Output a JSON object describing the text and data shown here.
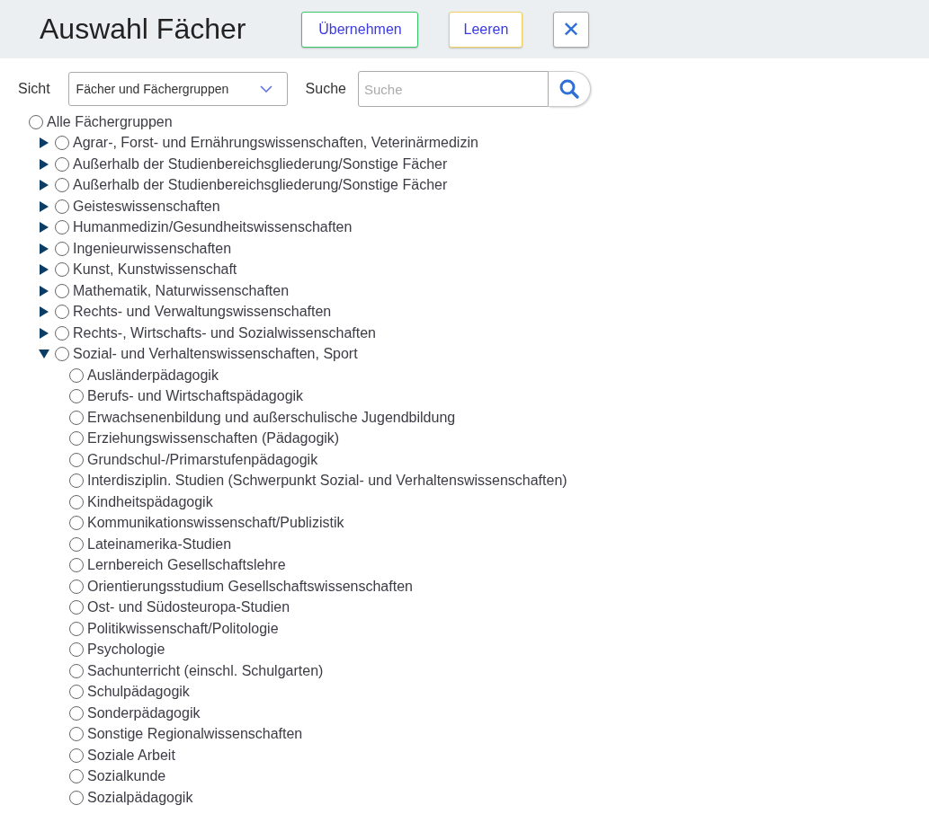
{
  "header": {
    "title": "Auswahl Fächer",
    "buttons": [
      {
        "label": "Übernehmen",
        "kind": "apply"
      },
      {
        "label": "Leeren",
        "kind": "clear"
      }
    ],
    "close": {
      "label": "✕"
    }
  },
  "filters": {
    "view_label": "Sicht",
    "view_value": "Fächer und Fächergruppen",
    "search_label": "Suche",
    "search_placeholder": "Suche"
  },
  "tree": {
    "label": "Alle Fächergruppen",
    "selected": false,
    "children": [
      {
        "label": "Agrar-, Forst- und Ernährungswissenschaften, Veterinärmedizin",
        "selected": false,
        "expanded": false
      },
      {
        "label": "Außerhalb der Studienbereichsgliederung/Sonstige Fächer",
        "selected": false,
        "expanded": false
      },
      {
        "label": "Außerhalb der Studienbereichsgliederung/Sonstige Fächer",
        "selected": false,
        "expanded": false
      },
      {
        "label": "Geisteswissenschaften",
        "selected": false,
        "expanded": false
      },
      {
        "label": "Humanmedizin/Gesundheitswissenschaften",
        "selected": false,
        "expanded": false
      },
      {
        "label": "Ingenieurwissenschaften",
        "selected": false,
        "expanded": false
      },
      {
        "label": "Kunst, Kunstwissenschaft",
        "selected": false,
        "expanded": false
      },
      {
        "label": "Mathematik, Naturwissenschaften",
        "selected": false,
        "expanded": false
      },
      {
        "label": "Rechts- und Verwaltungswissenschaften",
        "selected": false,
        "expanded": false
      },
      {
        "label": "Rechts-, Wirtschafts- und Sozialwissenschaften",
        "selected": false,
        "expanded": false
      },
      {
        "label": "Sozial- und Verhaltenswissenschaften, Sport",
        "selected": false,
        "expanded": true,
        "children": [
          {
            "label": "Ausländerpädagogik",
            "selected": false
          },
          {
            "label": "Berufs- und Wirtschaftspädagogik",
            "selected": false
          },
          {
            "label": "Erwachsenenbildung und außerschulische Jugendbildung",
            "selected": false
          },
          {
            "label": "Erziehungswissenschaften (Pädagogik)",
            "selected": false
          },
          {
            "label": "Grundschul-/Primarstufenpädagogik",
            "selected": false
          },
          {
            "label": "Interdisziplin. Studien (Schwerpunkt Sozial- und Verhaltenswissenschaften)",
            "selected": false
          },
          {
            "label": "Kindheitspädagogik",
            "selected": false
          },
          {
            "label": "Kommunikationswissenschaft/Publizistik",
            "selected": false
          },
          {
            "label": "Lateinamerika-Studien",
            "selected": false
          },
          {
            "label": "Lernbereich Gesellschaftslehre",
            "selected": false
          },
          {
            "label": "Orientierungsstudium Gesellschaftswissenschaften",
            "selected": false
          },
          {
            "label": "Ost- und Südosteuropa-Studien",
            "selected": false
          },
          {
            "label": "Politikwissenschaft/Politologie",
            "selected": false
          },
          {
            "label": "Psychologie",
            "selected": false
          },
          {
            "label": "Sachunterricht (einschl. Schulgarten)",
            "selected": false
          },
          {
            "label": "Schulpädagogik",
            "selected": false
          },
          {
            "label": "Sonderpädagogik",
            "selected": false
          },
          {
            "label": "Sonstige Regionalwissenschaften",
            "selected": false
          },
          {
            "label": "Soziale Arbeit",
            "selected": false
          },
          {
            "label": "Sozialkunde",
            "selected": false
          },
          {
            "label": "Sozialpädagogik",
            "selected": false
          }
        ]
      }
    ]
  }
}
